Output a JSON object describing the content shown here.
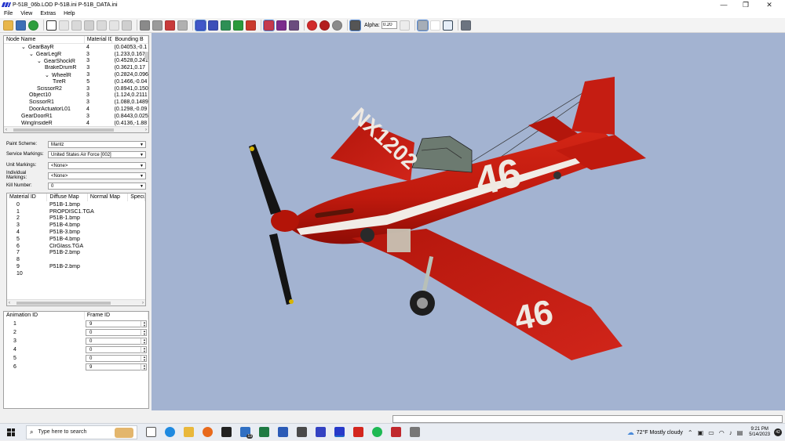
{
  "window": {
    "title": "P-51B_06b.LOD  P-51B.ini  P-51B_DATA.ini",
    "minimize_glyph": "—",
    "maximize_glyph": "❐",
    "close_glyph": "✕"
  },
  "menu": [
    "File",
    "View",
    "Extras",
    "Help"
  ],
  "toolbar": {
    "alpha_label": "Alpha:",
    "alpha_value": "0.20"
  },
  "node_tree": {
    "columns": [
      "Node Name",
      "Material ID",
      "Bounding B"
    ],
    "rows": [
      {
        "name": "GearBayR",
        "mat": "4",
        "bb": "(0.04053,-0.1",
        "level": 0,
        "arrow": "⌄"
      },
      {
        "name": "GearLegR",
        "mat": "3",
        "bb": "(1.233,0.1673",
        "level": 1,
        "arrow": "⌄"
      },
      {
        "name": "GearShockR",
        "mat": "3",
        "bb": "(0.4528,0.241",
        "level": 2,
        "arrow": "⌄"
      },
      {
        "name": "BrakeDrumR",
        "mat": "3",
        "bb": "(0.3621,0.17",
        "level": 3,
        "arrow": ""
      },
      {
        "name": "WheelR",
        "mat": "3",
        "bb": "(0.2824,0.096",
        "level": 3,
        "arrow": "⌄"
      },
      {
        "name": "TireR",
        "mat": "5",
        "bb": "(0.1466,-0.04",
        "level": 4,
        "arrow": ""
      },
      {
        "name": "ScissorR2",
        "mat": "3",
        "bb": "(0.8941,0.150",
        "level": 2,
        "arrow": ""
      },
      {
        "name": "Object10",
        "mat": "3",
        "bb": "(1.124,0.2111",
        "level": 1,
        "arrow": ""
      },
      {
        "name": "ScissorR1",
        "mat": "3",
        "bb": "(1.088,0.1489",
        "level": 1,
        "arrow": ""
      },
      {
        "name": "DoorActuatorL01",
        "mat": "4",
        "bb": "(0.1298,-0.09",
        "level": 1,
        "arrow": ""
      },
      {
        "name": "GearDoorR1",
        "mat": "3",
        "bb": "(0.8443,0.025",
        "level": 0,
        "arrow": ""
      },
      {
        "name": "WingInsideR",
        "mat": "4",
        "bb": "(0.4136,-1.88",
        "level": 0,
        "arrow": ""
      }
    ]
  },
  "settings": [
    {
      "label": "Paint Scheme:",
      "value": "Mantz"
    },
    {
      "label": "Service Markings:",
      "value": "United States Air Force [002]"
    },
    {
      "label": "Unit Markings:",
      "value": "<None>"
    },
    {
      "label": "Individual Markings:",
      "value": "<None>"
    },
    {
      "label": "Kill Number:",
      "value": "0"
    }
  ],
  "materials": {
    "columns": [
      "Material ID",
      "Diffuse Map",
      "Normal Map",
      "Specu"
    ],
    "rows": [
      {
        "id": "0",
        "diffuse": "P51B-1.bmp"
      },
      {
        "id": "1",
        "diffuse": "PROPDISC1.TGA"
      },
      {
        "id": "2",
        "diffuse": "P51B-1.bmp"
      },
      {
        "id": "3",
        "diffuse": "P51B-4.bmp"
      },
      {
        "id": "4",
        "diffuse": "P51B-3.bmp"
      },
      {
        "id": "5",
        "diffuse": "P51B-4.bmp"
      },
      {
        "id": "6",
        "diffuse": "ClrGlass.TGA"
      },
      {
        "id": "7",
        "diffuse": "P51B-2.bmp"
      },
      {
        "id": "8",
        "diffuse": ""
      },
      {
        "id": "9",
        "diffuse": "P51B-2.bmp"
      },
      {
        "id": "10",
        "diffuse": ""
      }
    ]
  },
  "animations": {
    "columns": [
      "Animation ID",
      "Frame ID"
    ],
    "rows": [
      {
        "id": "1",
        "frame": "9"
      },
      {
        "id": "2",
        "frame": "0"
      },
      {
        "id": "3",
        "frame": "0"
      },
      {
        "id": "4",
        "frame": "0"
      },
      {
        "id": "5",
        "frame": "0"
      },
      {
        "id": "6",
        "frame": "9"
      }
    ]
  },
  "aircraft": {
    "registration": "NX1202",
    "race_number": "46",
    "body_color": "#c81a10",
    "dark_color": "#8f0d07"
  },
  "taskbar": {
    "search_placeholder": "Type here to search",
    "mail_badge": "13",
    "weather": "72°F  Mostly cloudy",
    "time": "9:21 PM",
    "date": "5/14/2023",
    "notifications": "42"
  }
}
